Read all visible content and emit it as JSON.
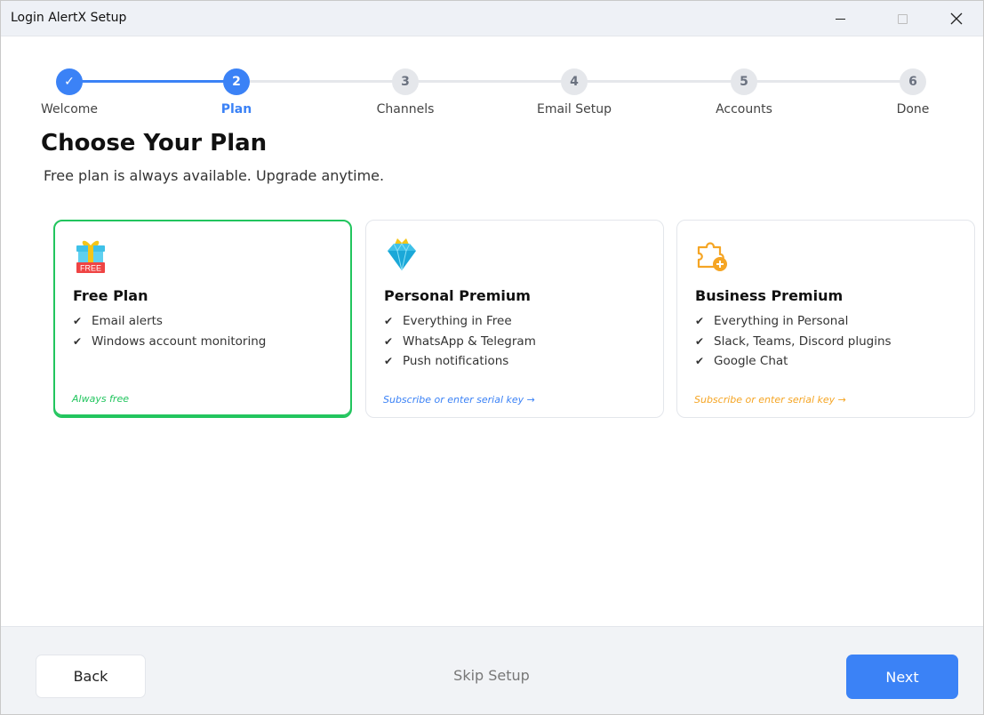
{
  "window": {
    "title": "Login AlertX Setup",
    "controls": [
      "minimize-icon",
      "maximize-icon",
      "close-icon"
    ],
    "close_glyph": "✕"
  },
  "stepper": {
    "steps": [
      {
        "number": "✓",
        "label": "Welcome",
        "state": "done"
      },
      {
        "number": "2",
        "label": "Plan",
        "state": "active"
      },
      {
        "number": "3",
        "label": "Channels",
        "state": "todo"
      },
      {
        "number": "4",
        "label": "Email Setup",
        "state": "todo"
      },
      {
        "number": "5",
        "label": "Accounts",
        "state": "todo"
      },
      {
        "number": "6",
        "label": "Done",
        "state": "todo"
      }
    ],
    "accent_color": "#3b82f6"
  },
  "page": {
    "title": "Choose Your Plan",
    "subtitle": "Free plan is always available. Upgrade anytime."
  },
  "plans": [
    {
      "icon": "gift-free-icon",
      "icon_text": "FREE",
      "title": "Free Plan",
      "features": [
        "Email alerts",
        "Windows account monitoring"
      ],
      "footer": "Always free",
      "color": "#22c55e",
      "selected": true
    },
    {
      "icon": "diamond-crown-icon",
      "title": "Personal Premium",
      "features": [
        "Everything in Free",
        "WhatsApp & Telegram",
        "Push notifications"
      ],
      "footer": "Subscribe or enter serial key →",
      "color": "#3b82f6",
      "selected": false
    },
    {
      "icon": "puzzle-plus-icon",
      "title": "Business Premium",
      "features": [
        "Everything in Personal",
        "Slack, Teams, Discord plugins",
        "Google Chat"
      ],
      "footer": "Subscribe or enter serial key →",
      "color": "#f5a524",
      "selected": false
    }
  ],
  "footer": {
    "back_label": "Back",
    "skip_label": "Skip Setup",
    "next_label": "Next"
  }
}
